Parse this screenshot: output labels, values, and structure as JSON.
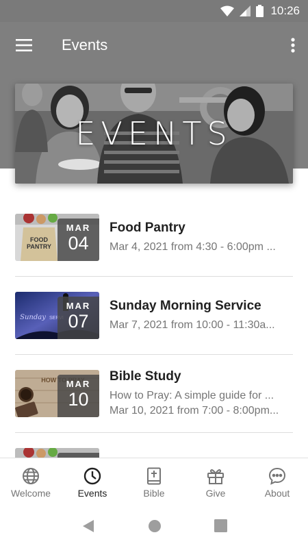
{
  "status_bar": {
    "time": "10:26"
  },
  "app_bar": {
    "title": "Events"
  },
  "hero": {
    "title": "EVENTS"
  },
  "events": [
    {
      "title": "Food Pantry",
      "month": "MAR",
      "day": "04",
      "lines": [
        "Mar 4, 2021 from 4:30 - 6:00pm ..."
      ],
      "thumb_text": "FOOD PANTRY"
    },
    {
      "title": "Sunday Morning Service",
      "month": "MAR",
      "day": "07",
      "lines": [
        "Mar 7, 2021 from 10:00 - 11:30a..."
      ],
      "thumb_text": "Sunday SERVI"
    },
    {
      "title": "Bible Study",
      "month": "MAR",
      "day": "10",
      "lines": [
        "How to Pray: A simple guide for ...",
        "Mar 10, 2021 from 7:00 - 8:00pm..."
      ],
      "thumb_text": "HOW TO PRAY"
    },
    {
      "title": "",
      "month": "",
      "day": "",
      "lines": []
    }
  ],
  "bottom_nav": [
    {
      "label": "Welcome",
      "icon": "globe-icon"
    },
    {
      "label": "Events",
      "icon": "clock-icon",
      "active": true
    },
    {
      "label": "Bible",
      "icon": "bible-icon"
    },
    {
      "label": "Give",
      "icon": "gift-icon"
    },
    {
      "label": "About",
      "icon": "chat-bubble-icon"
    }
  ],
  "colors": {
    "app_bar": "#7f7f7f",
    "status_bar": "#7a7a7a",
    "date_box": "#464646"
  }
}
